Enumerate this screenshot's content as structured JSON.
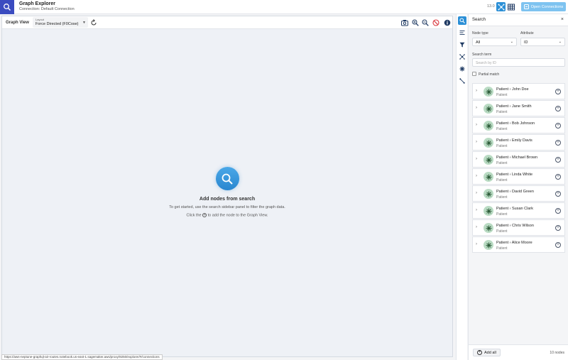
{
  "header": {
    "app_title": "Graph Explorer",
    "connection": "Connection: Default Connection",
    "version": "13.0",
    "open_connections_label": "Open Connections"
  },
  "graph_view": {
    "title": "Graph View",
    "layout_label": "Layout",
    "layout_value": "Force Directed (F0Cose)",
    "empty_title": "Add nodes from search",
    "empty_line1": "To get started, use the search sidebar panel to filter the graph data.",
    "empty_line2_prefix": "Click the",
    "empty_line2_suffix": "to add the node to the Graph View."
  },
  "status_url": "https://aws-neptune-graphql-air-routes.notebook.us-east-1.sagemaker.aws/proxy/9250/explorer/#/connections",
  "search": {
    "title": "Search",
    "node_type_label": "Node type",
    "node_type_value": "All",
    "attribute_label": "Attribute",
    "attribute_value": "ID",
    "search_term_label": "Search term",
    "search_placeholder": "Search by ID",
    "partial_match_label": "Partial match",
    "results": [
      {
        "title": "Patient › John Doe",
        "type": "Patient"
      },
      {
        "title": "Patient › Jane Smith",
        "type": "Patient"
      },
      {
        "title": "Patient › Bob Johnson",
        "type": "Patient"
      },
      {
        "title": "Patient › Emily Davis",
        "type": "Patient"
      },
      {
        "title": "Patient › Michael Brown",
        "type": "Patient"
      },
      {
        "title": "Patient › Linda White",
        "type": "Patient"
      },
      {
        "title": "Patient › David Green",
        "type": "Patient"
      },
      {
        "title": "Patient › Susan Clark",
        "type": "Patient"
      },
      {
        "title": "Patient › Chris Wilson",
        "type": "Patient"
      },
      {
        "title": "Patient › Alice Moore",
        "type": "Patient"
      }
    ],
    "add_all_label": "Add all",
    "count_label": "10 nodes"
  },
  "colors": {
    "brand": "#3b4cc0",
    "accent": "#2b8fd6",
    "open_connections_bg": "#7ec3f0",
    "node_avatar": "#b9dbc3"
  }
}
